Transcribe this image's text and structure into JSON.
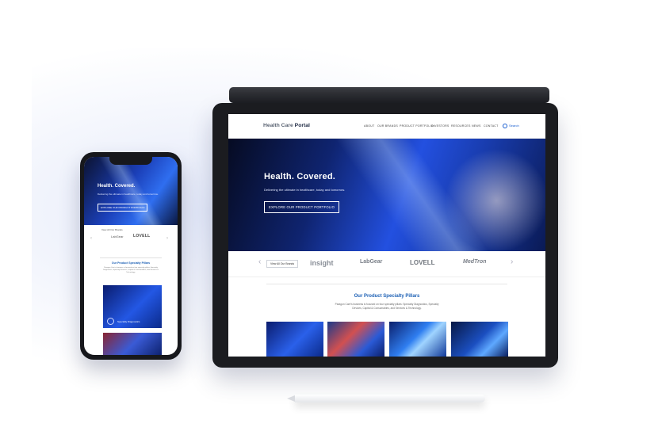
{
  "site": {
    "logo_prefix": "Health Care ",
    "logo_strong": "Portal"
  },
  "nav": {
    "items": [
      "ABOUT",
      "OUR BRANDS",
      "PRODUCT PORTFOLIO",
      "INVESTORS",
      "RESOURCES",
      "NEWS",
      "CONTACT"
    ],
    "search_label": "Search"
  },
  "hero": {
    "title": "Health. Covered.",
    "subtitle": "Delivering the ultimate in healthcare, today and tomorrow.",
    "button": "EXPLORE OUR PRODUCT PORTFOLIO"
  },
  "brands": {
    "view_all": "View All Our Brands",
    "logos": [
      "insight",
      "LabGear",
      "LOVELL",
      "MedTron"
    ]
  },
  "pillars": {
    "title": "Our Product Specialty Pillars",
    "text": "Paragon Care's business is focused on four specialty pillars: Specialty Diagnostics, Specialty Devices, Capital & Consumables, and Services & Technology."
  },
  "phone": {
    "card_label": "Specialty Diagnostics",
    "logos": [
      "LabGear",
      "LOVELL"
    ]
  },
  "colors": {
    "accent": "#1b5fb4",
    "hero_blue": "#2350e0"
  }
}
